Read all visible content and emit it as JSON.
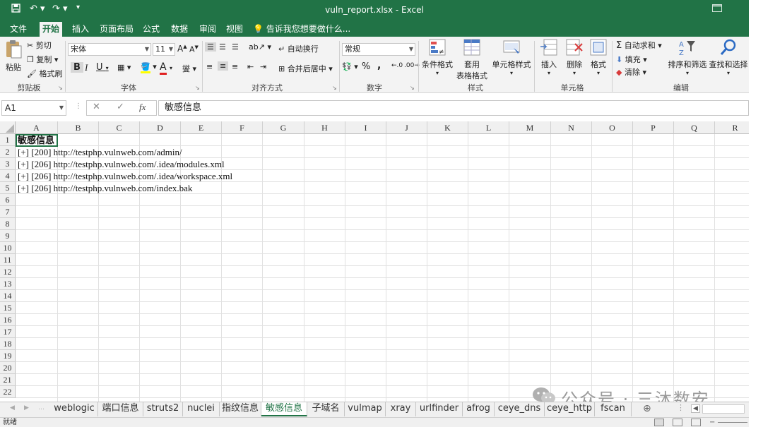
{
  "window": {
    "title": "vuln_report.xlsx - Excel"
  },
  "ribbon_tabs": [
    "文件",
    "开始",
    "插入",
    "页面布局",
    "公式",
    "数据",
    "审阅",
    "视图"
  ],
  "active_tab": "开始",
  "tell_me": "告诉我您想要做什么...",
  "ribbon": {
    "clipboard": {
      "paste": "粘贴",
      "cut": "剪切",
      "copy": "复制",
      "format_painter": "格式刷",
      "label": "剪贴板"
    },
    "font": {
      "family": "宋体",
      "size": "11",
      "bold": "B",
      "italic": "I",
      "underline": "U",
      "label": "字体"
    },
    "alignment": {
      "wrap": "自动换行",
      "merge": "合并后居中",
      "label": "对齐方式"
    },
    "number": {
      "format": "常规",
      "percent": "%",
      "comma": ",",
      "label": "数字"
    },
    "styles": {
      "conditional": "条件格式",
      "table_line1": "套用",
      "table_line2": "表格格式",
      "cell_styles": "单元格样式",
      "label": "样式"
    },
    "cells": {
      "insert": "插入",
      "delete": "删除",
      "format": "格式",
      "label": "单元格"
    },
    "editing": {
      "autosum": "自动求和",
      "fill": "填充",
      "clear": "清除",
      "sort": "排序和筛选",
      "find": "查找和选择",
      "label": "编辑"
    }
  },
  "formula_bar": {
    "name_box": "A1",
    "fx": "fx",
    "content": "敏感信息"
  },
  "columns": [
    "A",
    "B",
    "C",
    "D",
    "E",
    "F",
    "G",
    "H",
    "I",
    "J",
    "K",
    "L",
    "M",
    "N",
    "O",
    "P",
    "Q",
    "R"
  ],
  "rows": [
    "1",
    "2",
    "3",
    "4",
    "5",
    "6",
    "7",
    "8",
    "9",
    "10",
    "11",
    "12",
    "13",
    "14",
    "15",
    "16",
    "17",
    "18",
    "19",
    "20",
    "21",
    "22"
  ],
  "cells": [
    "敏感信息",
    "[+] [200] http://testphp.vulnweb.com/admin/",
    "[+] [206] http://testphp.vulnweb.com/.idea/modules.xml",
    "[+] [206] http://testphp.vulnweb.com/.idea/workspace.xml",
    "[+] [206] http://testphp.vulnweb.com/index.bak"
  ],
  "sheet_tabs": [
    "weblogic",
    "端口信息",
    "struts2",
    "nuclei",
    "指纹信息",
    "敏感信息",
    "子域名",
    "vulmap",
    "xray",
    "urlfinder",
    "afrog",
    "ceye_dns",
    "ceye_http",
    "fscan"
  ],
  "active_sheet": "敏感信息",
  "status": "就绪",
  "watermark": "公众号 · 三沐数安",
  "colors": {
    "accent": "#217346"
  }
}
